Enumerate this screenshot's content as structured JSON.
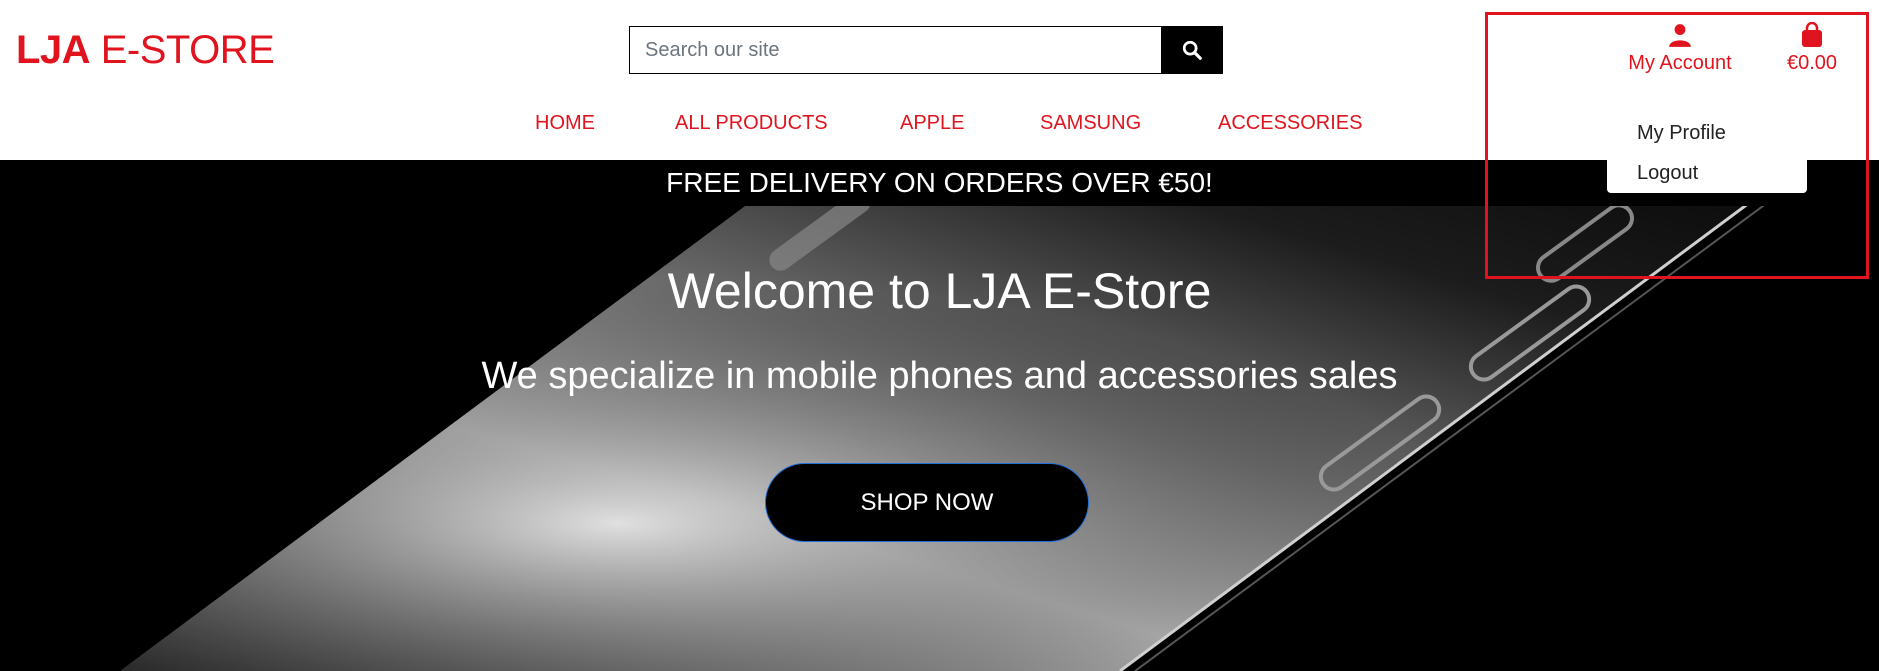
{
  "header": {
    "logo_bold": "LJA",
    "logo_rest": "E-STORE",
    "search": {
      "placeholder": "Search our site",
      "value": ""
    },
    "account_label": "My Account",
    "bag_total": "€0.00"
  },
  "nav": {
    "items": [
      {
        "label": "HOME"
      },
      {
        "label": "ALL PRODUCTS"
      },
      {
        "label": "APPLE"
      },
      {
        "label": "SAMSUNG"
      },
      {
        "label": "ACCESSORIES"
      }
    ]
  },
  "account_menu": {
    "items": [
      {
        "label": "My Profile"
      },
      {
        "label": "Logout"
      }
    ]
  },
  "banner": {
    "text": "FREE DELIVERY ON ORDERS OVER €50!"
  },
  "hero": {
    "title": "Welcome to LJA E-Store",
    "subtitle": "We specialize in mobile phones and accessories sales",
    "cta_label": "SHOP NOW"
  },
  "colors": {
    "brand": "#e0141e",
    "cta_border": "#1e6fd9",
    "highlight": "#e0141e"
  },
  "icons": {
    "search": "search-icon",
    "account": "user-icon",
    "bag": "shopping-bag-icon"
  }
}
